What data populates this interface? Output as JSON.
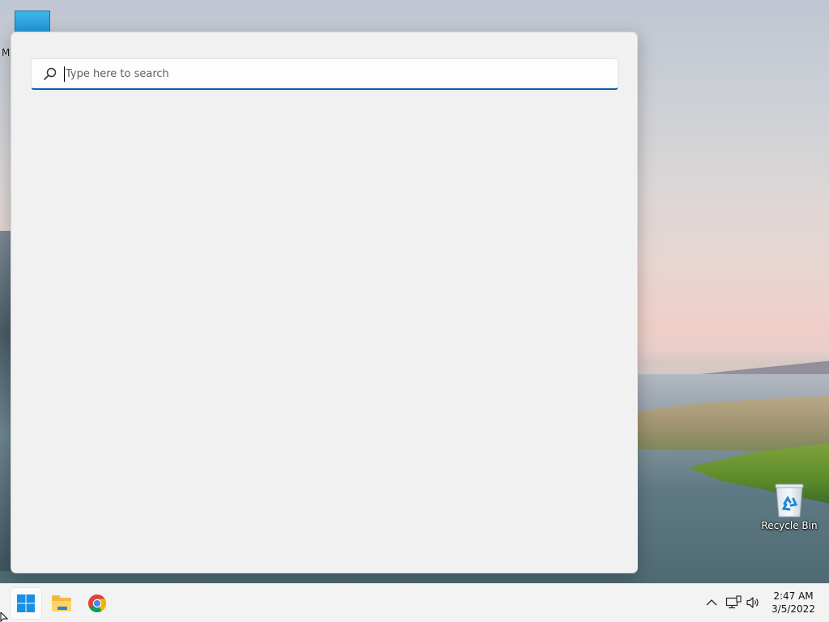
{
  "desktop": {
    "icons": [
      {
        "id": "this-pc",
        "label": "M"
      },
      {
        "id": "recycle-bin",
        "label": "Recycle Bin"
      }
    ]
  },
  "search_panel": {
    "search": {
      "placeholder": "Type here to search",
      "value": ""
    },
    "accent_color": "#0b5ea6"
  },
  "taskbar": {
    "pinned": [
      {
        "name": "start-button",
        "icon": "windows-logo-icon"
      },
      {
        "name": "file-explorer",
        "icon": "folder-icon"
      },
      {
        "name": "chrome",
        "icon": "chrome-icon"
      }
    ],
    "tray": {
      "icons": [
        "chevron-up-icon",
        "network-icon",
        "volume-icon"
      ]
    },
    "clock": {
      "time": "2:47 AM",
      "date": "3/5/2022"
    }
  }
}
